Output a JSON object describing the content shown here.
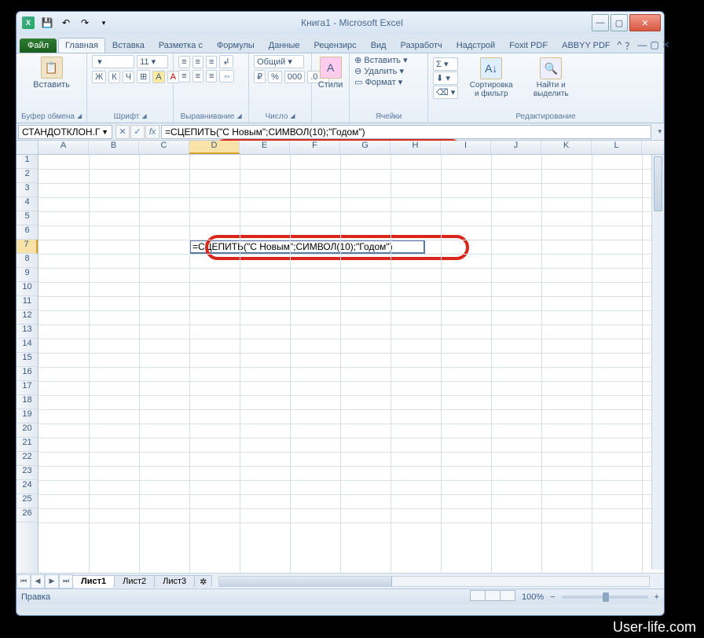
{
  "title": "Книга1 - Microsoft Excel",
  "qat_icons": [
    "save",
    "undo",
    "redo"
  ],
  "win": {
    "min": "—",
    "max": "▢",
    "close": "✕"
  },
  "tabs": {
    "file": "Файл",
    "list": [
      "Главная",
      "Вставка",
      "Разметка с",
      "Формулы",
      "Данные",
      "Рецензирс",
      "Вид",
      "Разработч",
      "Надстрой",
      "Foxit PDF",
      "ABBYY PDF"
    ],
    "active_index": 0
  },
  "ribbon": {
    "clipboard": {
      "paste": "Вставить",
      "label": "Буфер обмена"
    },
    "font": {
      "label": "Шрифт",
      "name_placeholder": "",
      "size": "11",
      "buttons": [
        "Ж",
        "К",
        "Ч"
      ]
    },
    "alignment": {
      "label": "Выравнивание"
    },
    "number": {
      "label": "Число",
      "format": "Общий"
    },
    "styles": {
      "label": "Стили",
      "btn": "Стили"
    },
    "cells": {
      "label": "Ячейки",
      "insert": "Вставить",
      "delete": "Удалить",
      "format": "Формат"
    },
    "editing": {
      "label": "Редактирование",
      "sort": "Сортировка и фильтр",
      "find": "Найти и выделить"
    }
  },
  "formula_bar": {
    "name_box": "СТАНДОТКЛОН.Г",
    "formula": "=СЦЕПИТЬ(\"С Новым\";СИМВОЛ(10);\"Годом\")"
  },
  "grid": {
    "columns": [
      "A",
      "B",
      "C",
      "D",
      "E",
      "F",
      "G",
      "H",
      "I",
      "J",
      "K",
      "L"
    ],
    "active_col_index": 3,
    "rows": 26,
    "active_row": 7,
    "cell_content": "=СЦЕПИТЬ(\"С Новым\";СИМВОЛ(10);\"Годом\")"
  },
  "sheets": {
    "list": [
      "Лист1",
      "Лист2",
      "Лист3"
    ],
    "active_index": 0
  },
  "status": {
    "mode": "Правка",
    "zoom": "100%",
    "zoom_minus": "−",
    "zoom_plus": "+"
  },
  "watermark": "User-life.com"
}
